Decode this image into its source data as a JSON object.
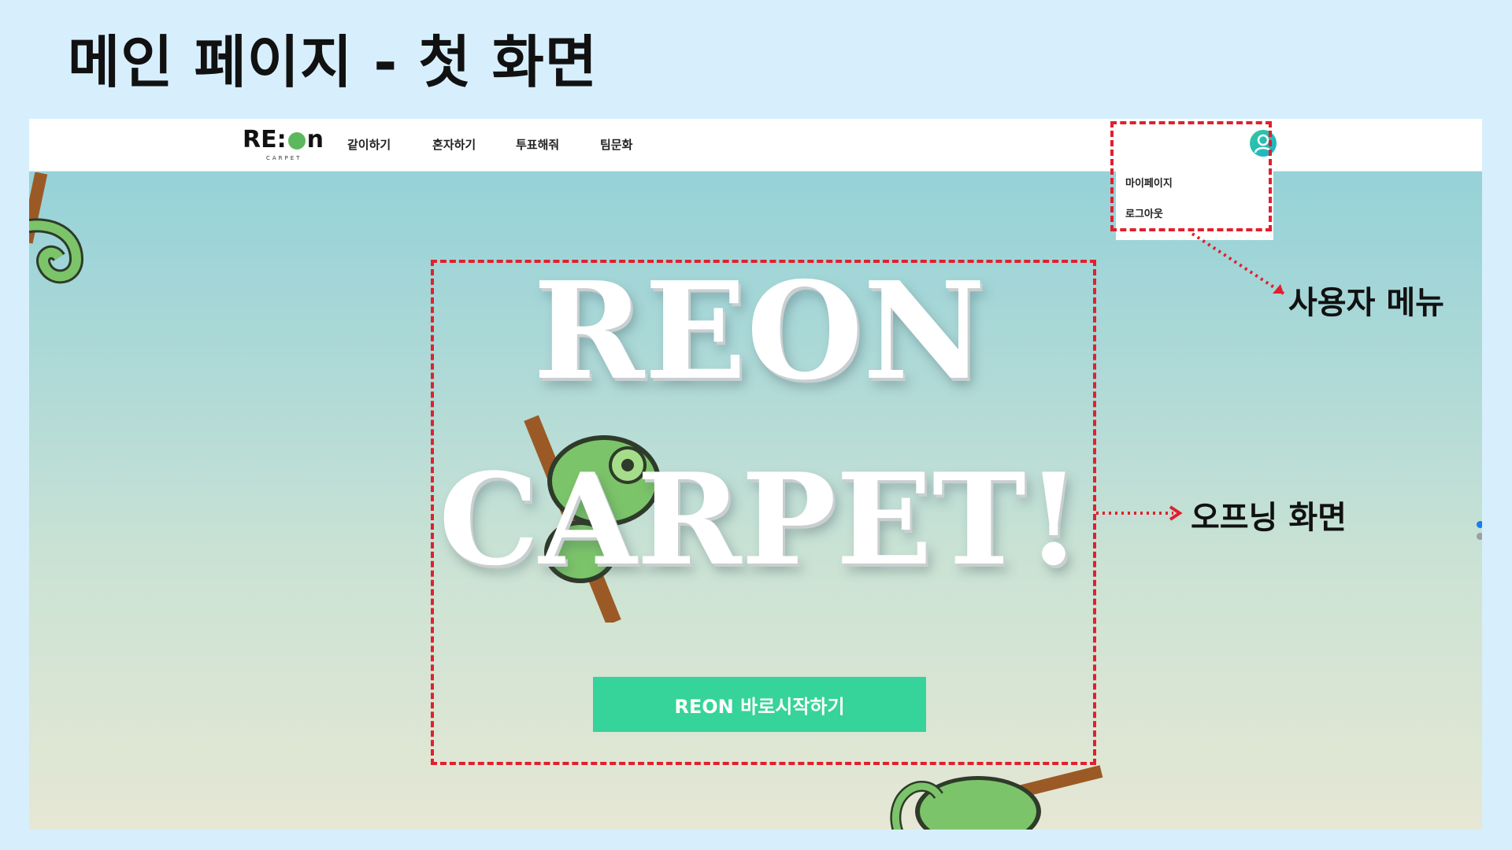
{
  "slide": {
    "title": "메인 페이지 - 첫 화면"
  },
  "navbar": {
    "logo_text": "RE:",
    "logo_text_tail": "n",
    "logo_sub": "CARPET",
    "items": [
      {
        "label": "같이하기"
      },
      {
        "label": "혼자하기"
      },
      {
        "label": "투표해줘"
      },
      {
        "label": "팀문화"
      }
    ]
  },
  "user_menu": {
    "items": [
      {
        "label": "마이페이지"
      },
      {
        "label": "로그아웃"
      }
    ]
  },
  "hero": {
    "line1": "REON",
    "line2": "CARPET!",
    "cta_label": "REON 바로시작하기"
  },
  "annotations": {
    "user_menu_label": "사용자 메뉴",
    "opening_label": "오프닝 화면"
  },
  "colors": {
    "background": "#d7effc",
    "accent_green": "#36d39a",
    "annotation_red": "#e0202e",
    "chameleon_green": "#7cc46a",
    "branch_brown": "#9b5a25"
  }
}
